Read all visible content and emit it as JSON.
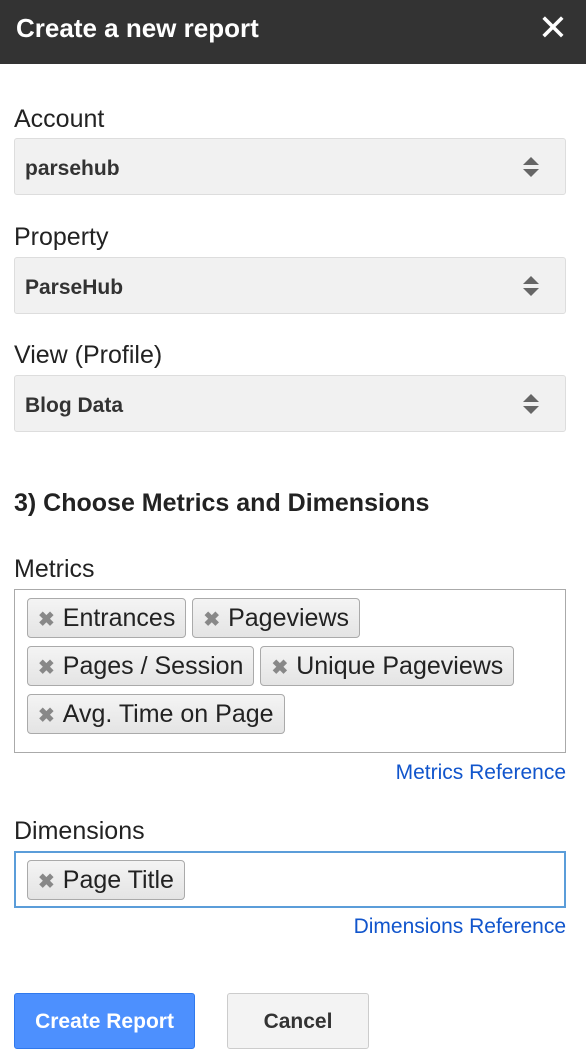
{
  "header": {
    "title": "Create a new report",
    "close_icon": "close-icon"
  },
  "account": {
    "label": "Account",
    "value": "parsehub"
  },
  "property": {
    "label": "Property",
    "value": "ParseHub"
  },
  "view": {
    "label": "View (Profile)",
    "value": "Blog Data"
  },
  "section3": {
    "heading": "3) Choose Metrics and Dimensions"
  },
  "metrics": {
    "label": "Metrics",
    "chips": [
      "Entrances",
      "Pageviews",
      "Pages / Session",
      "Unique Pageviews",
      "Avg. Time on Page"
    ],
    "reference_link": "Metrics Reference"
  },
  "dimensions": {
    "label": "Dimensions",
    "chips": [
      "Page Title"
    ],
    "reference_link": "Dimensions Reference"
  },
  "remove_glyph": "✖",
  "buttons": {
    "create": "Create Report",
    "cancel": "Cancel"
  },
  "colors": {
    "header": "#333333",
    "primary": "#4d90fe",
    "link": "#1155cc"
  }
}
